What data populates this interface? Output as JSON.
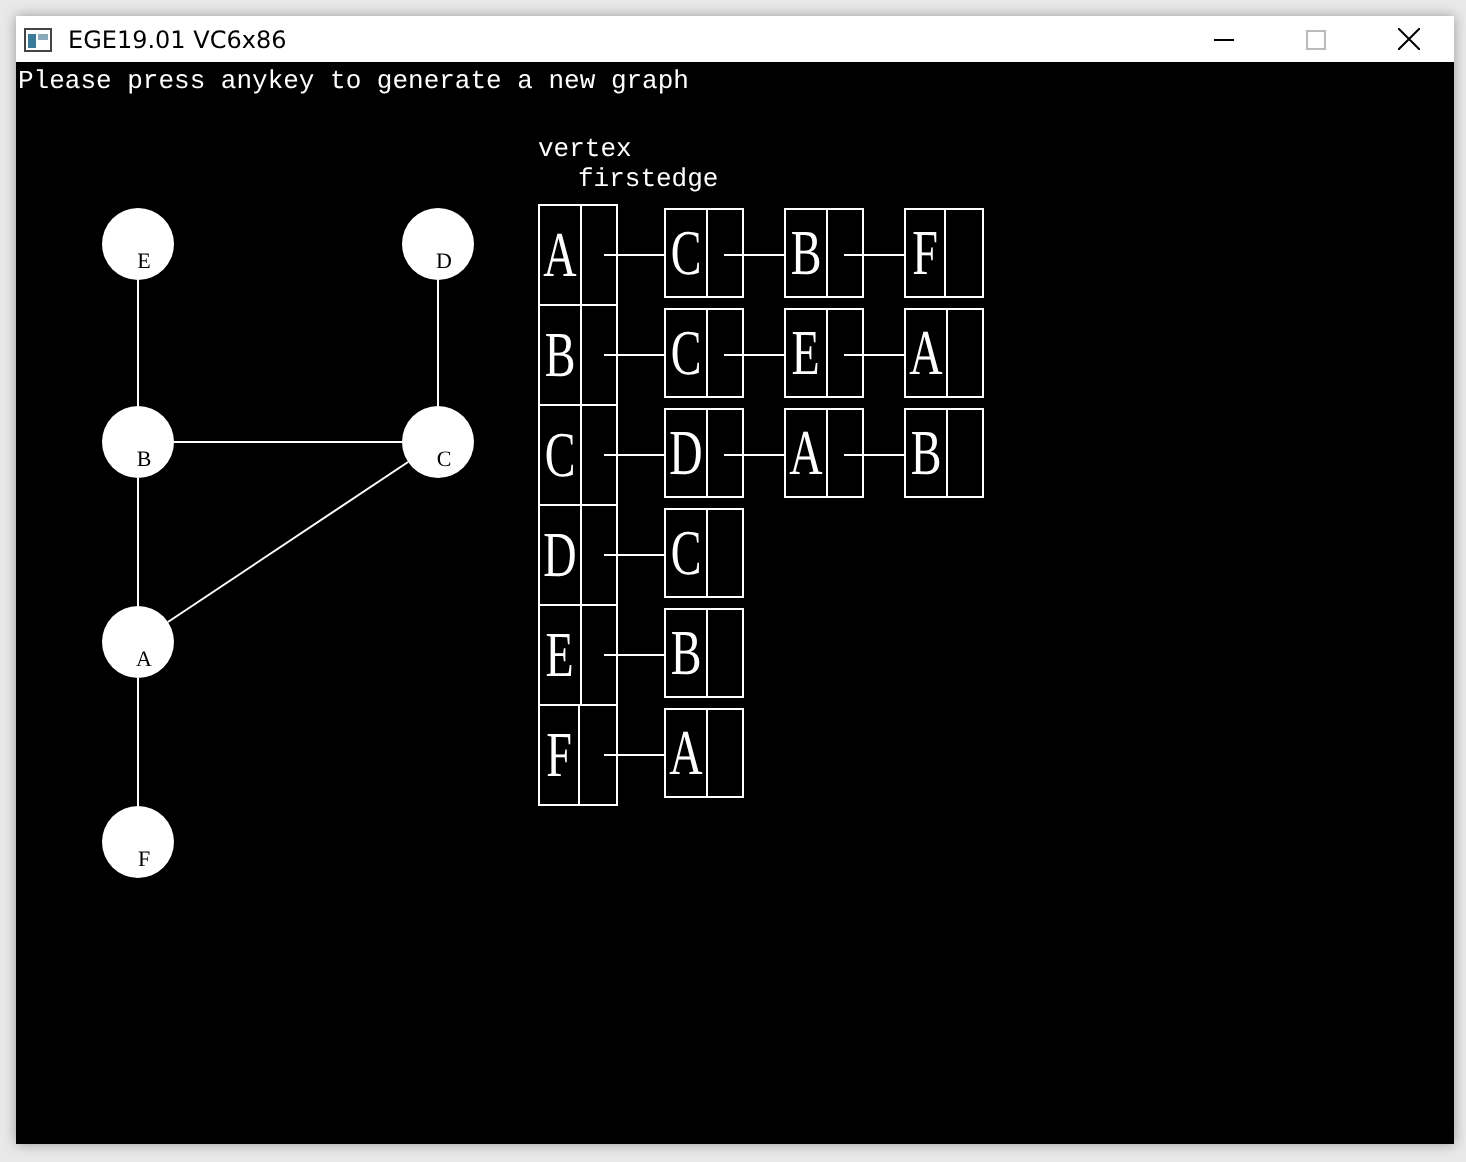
{
  "window": {
    "title": "EGE19.01 VC6x86"
  },
  "prompt": "Please press anykey to generate a new graph",
  "graph": {
    "nodes": [
      "E",
      "D",
      "B",
      "C",
      "A",
      "F"
    ]
  },
  "adjacency": {
    "header_vertex": "vertex",
    "header_firstedge": "firstedge",
    "rows": [
      {
        "vertex": "A",
        "edges": [
          "C",
          "B",
          "F"
        ]
      },
      {
        "vertex": "B",
        "edges": [
          "C",
          "E",
          "A"
        ]
      },
      {
        "vertex": "C",
        "edges": [
          "D",
          "A",
          "B"
        ]
      },
      {
        "vertex": "D",
        "edges": [
          "C"
        ]
      },
      {
        "vertex": "E",
        "edges": [
          "B"
        ]
      },
      {
        "vertex": "F",
        "edges": [
          "A"
        ]
      }
    ]
  }
}
